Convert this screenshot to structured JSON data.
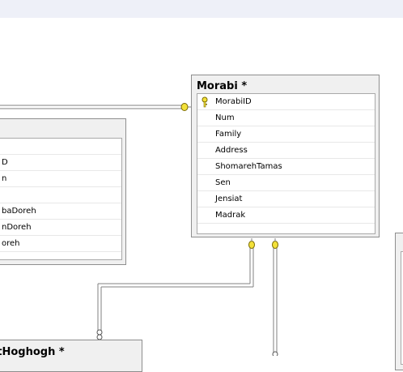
{
  "tables": {
    "morabi": {
      "title": "Morabi *",
      "columns": [
        "MorabiID",
        "Num",
        "Family",
        "Address",
        "ShomarehTamas",
        "Sen",
        "Jensiat",
        "Madrak"
      ],
      "primary_key_icon": "key-icon"
    },
    "left_table": {
      "columns": [
        "D",
        "n",
        "",
        "baDoreh",
        "nDoreh",
        "oreh"
      ]
    },
    "bottom_table": {
      "title": "htHoghogh *"
    }
  },
  "relationships": [
    {
      "from": "left_table",
      "to": "morabi",
      "end_icon": "key-connector-icon"
    },
    {
      "from": "morabi",
      "to": "bottom_table",
      "end_icon": "key-connector-icon"
    },
    {
      "from": "morabi",
      "to": "offscreen-table",
      "end_icon": "key-connector-icon"
    }
  ],
  "colors": {
    "table_border": "#8e8e8e",
    "table_header_bg": "#f0f0f0",
    "connector": "#808080",
    "key_yellow": "#f3e13a"
  }
}
